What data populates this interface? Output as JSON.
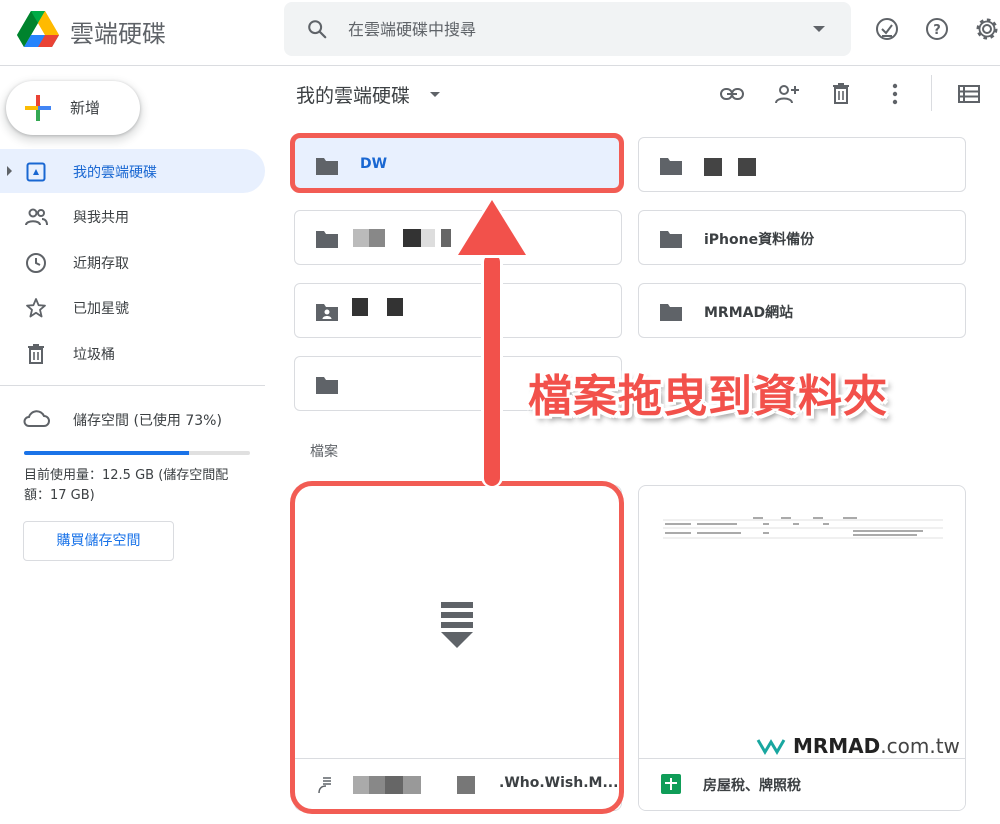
{
  "header": {
    "app_title": "雲端硬碟",
    "search_placeholder": "在雲端硬碟中搜尋"
  },
  "sidebar": {
    "new_label": "新增",
    "items": [
      {
        "label": "我的雲端硬碟",
        "icon": "my-drive-icon",
        "active": true
      },
      {
        "label": "與我共用",
        "icon": "shared-with-me-icon",
        "active": false
      },
      {
        "label": "近期存取",
        "icon": "clock-icon",
        "active": false
      },
      {
        "label": "已加星號",
        "icon": "star-icon",
        "active": false
      },
      {
        "label": "垃圾桶",
        "icon": "trash-icon",
        "active": false
      }
    ],
    "storage": {
      "label": "儲存空間 (已使用 73%)",
      "used_fraction": 0.73,
      "detail": "目前使用量：12.5 GB (儲存空間配額：17 GB)",
      "buy_label": "購買儲存空間"
    }
  },
  "main": {
    "breadcrumb": "我的雲端硬碟",
    "folders": [
      {
        "name": "DW",
        "selected": true
      },
      {
        "name": "",
        "selected": false
      },
      {
        "name": "",
        "selected": false
      },
      {
        "name": "iPhone資料備份",
        "selected": false
      },
      {
        "name": "",
        "selected": false
      },
      {
        "name": "MRMAD網站",
        "selected": false
      },
      {
        "name": "",
        "selected": false
      }
    ],
    "files_label": "檔案",
    "files": [
      {
        "name": ".Who.Wish.M..."
      },
      {
        "name": "房屋稅、牌照稅"
      }
    ]
  },
  "annotation": {
    "text": "檔案拖曳到資料夾",
    "watermark_brand": "MRMAD",
    "watermark_domain": ".com.tw"
  },
  "colors": {
    "accent": "#1a73e8",
    "selected_bg": "#e8f0fe",
    "annotation_red": "#f25c54"
  }
}
